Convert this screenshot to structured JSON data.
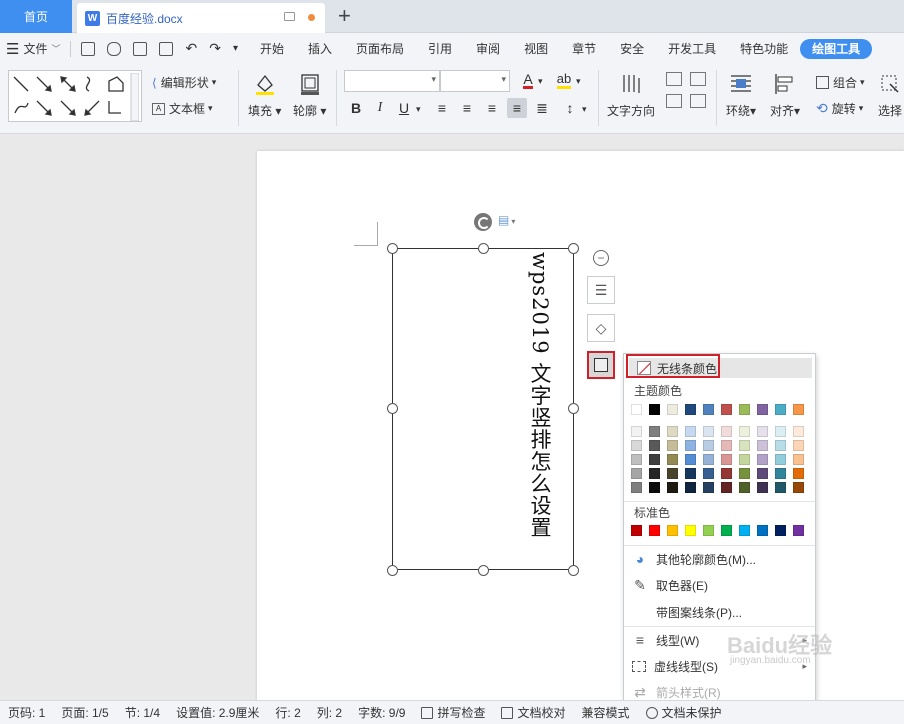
{
  "tabs": {
    "home": "首页",
    "doc_title": "百度经验.docx",
    "add": "+"
  },
  "menu": {
    "file": "文件",
    "items": [
      "开始",
      "插入",
      "页面布局",
      "引用",
      "审阅",
      "视图",
      "章节",
      "安全",
      "开发工具",
      "特色功能"
    ],
    "active": "绘图工具"
  },
  "ribbon": {
    "edit_shape": "编辑形状",
    "text_box": "文本框",
    "fill": "填充",
    "outline": "轮廓",
    "text_direction": "文字方向",
    "wrap": "环绕",
    "align": "对齐",
    "group": "组合",
    "rotate": "旋转",
    "select": "选择",
    "bold": "B",
    "italic": "I",
    "underline": "U",
    "font_color": "A",
    "highlight": "ab"
  },
  "document": {
    "vertical_text": "wps2019 文字竖排怎么设置"
  },
  "dropdown": {
    "no_line": "无线条颜色",
    "theme_colors": "主题颜色",
    "standard_colors": "标准色",
    "more_colors": "其他轮廓颜色(M)...",
    "eyedropper": "取色器(E)",
    "pattern_line": "带图案线条(P)...",
    "line_type": "线型(W)",
    "dash_type": "虚线线型(S)",
    "arrow_style": "箭头样式(R)",
    "theme_row": [
      "#ffffff",
      "#000000",
      "#eeece1",
      "#1f497d",
      "#4f81bd",
      "#c0504d",
      "#9bbb59",
      "#8064a2",
      "#4bacc6",
      "#f79646"
    ],
    "theme_shades": [
      [
        "#f2f2f2",
        "#7f7f7f",
        "#ddd9c3",
        "#c6d9f0",
        "#dbe5f1",
        "#f2dcdb",
        "#ebf1dd",
        "#e5e0ec",
        "#dbeef3",
        "#fdeada"
      ],
      [
        "#d8d8d8",
        "#595959",
        "#c4bd97",
        "#8db3e2",
        "#b8cce4",
        "#e5b9b7",
        "#d7e3bc",
        "#ccc1d9",
        "#b7dde8",
        "#fbd5b5"
      ],
      [
        "#bfbfbf",
        "#3f3f3f",
        "#938953",
        "#548dd4",
        "#95b3d7",
        "#d99694",
        "#c3d69b",
        "#b2a2c7",
        "#92cddc",
        "#fac08f"
      ],
      [
        "#a5a5a5",
        "#262626",
        "#494429",
        "#17365d",
        "#366092",
        "#953734",
        "#76923c",
        "#5f497a",
        "#31859b",
        "#e36c09"
      ],
      [
        "#7f7f7f",
        "#0c0c0c",
        "#1d1b10",
        "#0f243e",
        "#244061",
        "#632423",
        "#4f6128",
        "#3f3151",
        "#205867",
        "#974806"
      ]
    ],
    "standard_row": [
      "#c00000",
      "#ff0000",
      "#ffc000",
      "#ffff00",
      "#92d050",
      "#00b050",
      "#00b0f0",
      "#0070c0",
      "#002060",
      "#7030a0"
    ]
  },
  "status": {
    "page_code": "页码: 1",
    "page": "页面: 1/5",
    "section": "节: 1/4",
    "setting": "设置值: 2.9厘米",
    "row": "行: 2",
    "col": "列: 2",
    "words": "字数: 9/9",
    "spell": "拼写检查",
    "proof": "文档校对",
    "compat": "兼容模式",
    "protect": "文档未保护"
  },
  "watermark": {
    "main": "Baidu经验",
    "sub": "jingyan.baidu.com"
  }
}
